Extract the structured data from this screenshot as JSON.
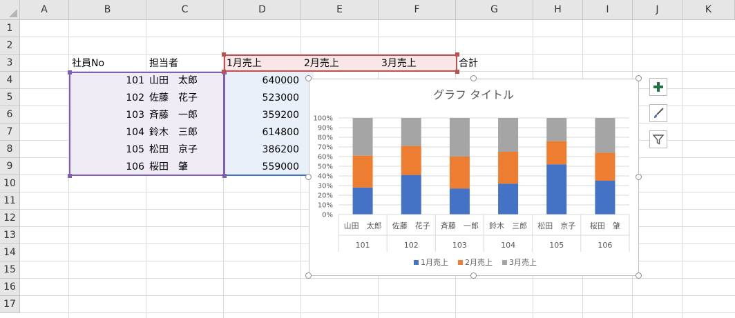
{
  "columns": [
    "A",
    "B",
    "C",
    "D",
    "E",
    "F",
    "G",
    "H",
    "I",
    "J",
    "K"
  ],
  "rows": [
    "1",
    "2",
    "3",
    "4",
    "5",
    "6",
    "7",
    "8",
    "9",
    "10",
    "11",
    "12",
    "13",
    "14",
    "15",
    "16",
    "17"
  ],
  "headers": {
    "B3": "社員No",
    "C3": "担当者",
    "D3": "1月売上",
    "E3": "2月売上",
    "F3": "3月売上",
    "G3": "合計"
  },
  "records": [
    {
      "no": "101",
      "name": "山田　太郎",
      "jan": "640000"
    },
    {
      "no": "102",
      "name": "佐藤　花子",
      "jan": "523000"
    },
    {
      "no": "103",
      "name": "斉藤　一郎",
      "jan": "359200"
    },
    {
      "no": "104",
      "name": "鈴木　三郎",
      "jan": "614800"
    },
    {
      "no": "105",
      "name": "松田　京子",
      "jan": "386200"
    },
    {
      "no": "106",
      "name": "桜田　肇",
      "jan": "559000"
    }
  ],
  "colors": {
    "series1": "#4472c4",
    "series2": "#ed7d31",
    "series3": "#a5a5a5",
    "accent_plus": "#217346"
  },
  "chart_tools": [
    "plus-icon",
    "brush-icon",
    "filter-icon"
  ],
  "chart_data": {
    "type": "bar",
    "stacked": "100%",
    "title": "グラフ タイトル",
    "categories": [
      {
        "name": "山田　太郎",
        "group": "101"
      },
      {
        "name": "佐藤　花子",
        "group": "102"
      },
      {
        "name": "斉藤　一郎",
        "group": "103"
      },
      {
        "name": "鈴木　三郎",
        "group": "104"
      },
      {
        "name": "松田　京子",
        "group": "105"
      },
      {
        "name": "桜田　肇",
        "group": "106"
      }
    ],
    "series": [
      {
        "name": "1月売上",
        "values": [
          0.28,
          0.41,
          0.27,
          0.32,
          0.52,
          0.35
        ]
      },
      {
        "name": "2月売上",
        "values": [
          0.33,
          0.3,
          0.33,
          0.33,
          0.24,
          0.29
        ]
      },
      {
        "name": "3月売上",
        "values": [
          0.39,
          0.29,
          0.4,
          0.35,
          0.24,
          0.36
        ]
      }
    ],
    "yticks": [
      "0%",
      "10%",
      "20%",
      "30%",
      "40%",
      "50%",
      "60%",
      "70%",
      "80%",
      "90%",
      "100%"
    ],
    "ylim": [
      0,
      1
    ],
    "grid": true,
    "legend": "bottom"
  }
}
